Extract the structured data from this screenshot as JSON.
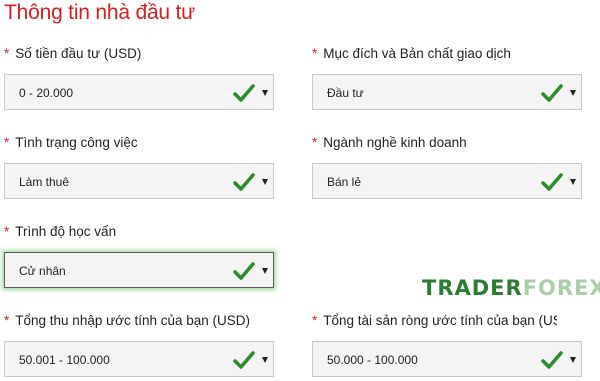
{
  "page": {
    "title": "Thông tin nhà đầu tư",
    "required_marker": "*",
    "accent_color": "#d81e1e",
    "check_color": "#2e8b2e"
  },
  "fields": {
    "investment_amount": {
      "label": "Số tiền đầu tư (USD)",
      "value": "0 - 20.000",
      "icon": "check-icon"
    },
    "purpose": {
      "label": "Mục đích và Bản chất giao dịch",
      "value": "Đầu tư",
      "icon": "check-icon"
    },
    "employment": {
      "label": "Tình trạng công việc",
      "value": "Làm thuê",
      "icon": "check-icon"
    },
    "industry": {
      "label": "Ngành nghề kinh doanh",
      "value": "Bán lẻ",
      "icon": "check-icon"
    },
    "education": {
      "label": "Trình độ học vấn",
      "value": "Cử nhân",
      "icon": "check-icon"
    },
    "income": {
      "label": "Tổng thu nhập ước tính của bạn (USD)",
      "value": "50.001 - 100.000",
      "icon": "check-icon"
    },
    "net_worth": {
      "label": "Tổng tài sản ròng ước tính của bạn (USD)",
      "value": "50.000 - 100.000",
      "icon": "check-icon"
    }
  },
  "watermark": {
    "part1": "TRADER",
    "part2": "FOREX"
  }
}
